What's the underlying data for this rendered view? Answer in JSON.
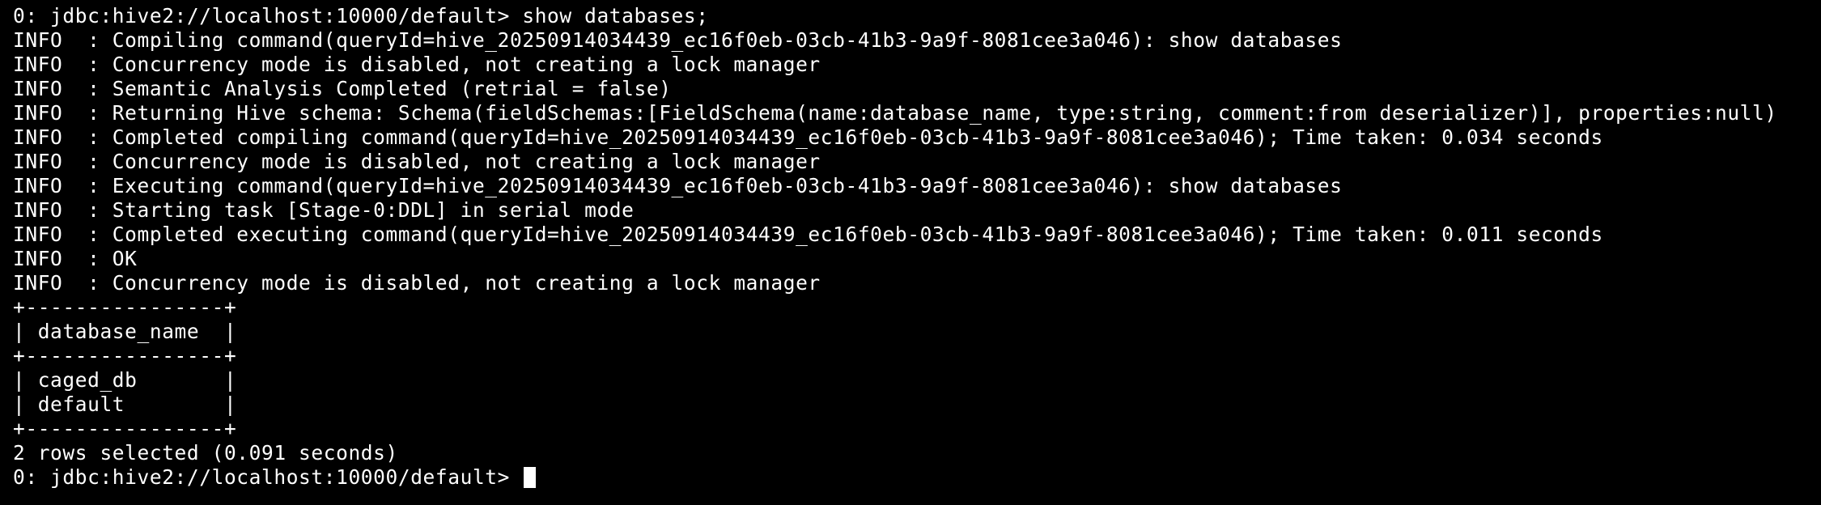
{
  "terminal": {
    "lines": [
      "0: jdbc:hive2://localhost:10000/default> show databases;",
      "INFO  : Compiling command(queryId=hive_20250914034439_ec16f0eb-03cb-41b3-9a9f-8081cee3a046): show databases",
      "INFO  : Concurrency mode is disabled, not creating a lock manager",
      "INFO  : Semantic Analysis Completed (retrial = false)",
      "INFO  : Returning Hive schema: Schema(fieldSchemas:[FieldSchema(name:database_name, type:string, comment:from deserializer)], properties:null)",
      "INFO  : Completed compiling command(queryId=hive_20250914034439_ec16f0eb-03cb-41b3-9a9f-8081cee3a046); Time taken: 0.034 seconds",
      "INFO  : Concurrency mode is disabled, not creating a lock manager",
      "INFO  : Executing command(queryId=hive_20250914034439_ec16f0eb-03cb-41b3-9a9f-8081cee3a046): show databases",
      "INFO  : Starting task [Stage-0:DDL] in serial mode",
      "INFO  : Completed executing command(queryId=hive_20250914034439_ec16f0eb-03cb-41b3-9a9f-8081cee3a046); Time taken: 0.011 seconds",
      "INFO  : OK",
      "INFO  : Concurrency mode is disabled, not creating a lock manager",
      "+----------------+",
      "| database_name  |",
      "+----------------+",
      "| caged_db       |",
      "| default        |",
      "+----------------+",
      "2 rows selected (0.091 seconds)"
    ],
    "prompt": "0: jdbc:hive2://localhost:10000/default> ",
    "colors": {
      "background": "#000000",
      "foreground": "#ffffff"
    }
  }
}
